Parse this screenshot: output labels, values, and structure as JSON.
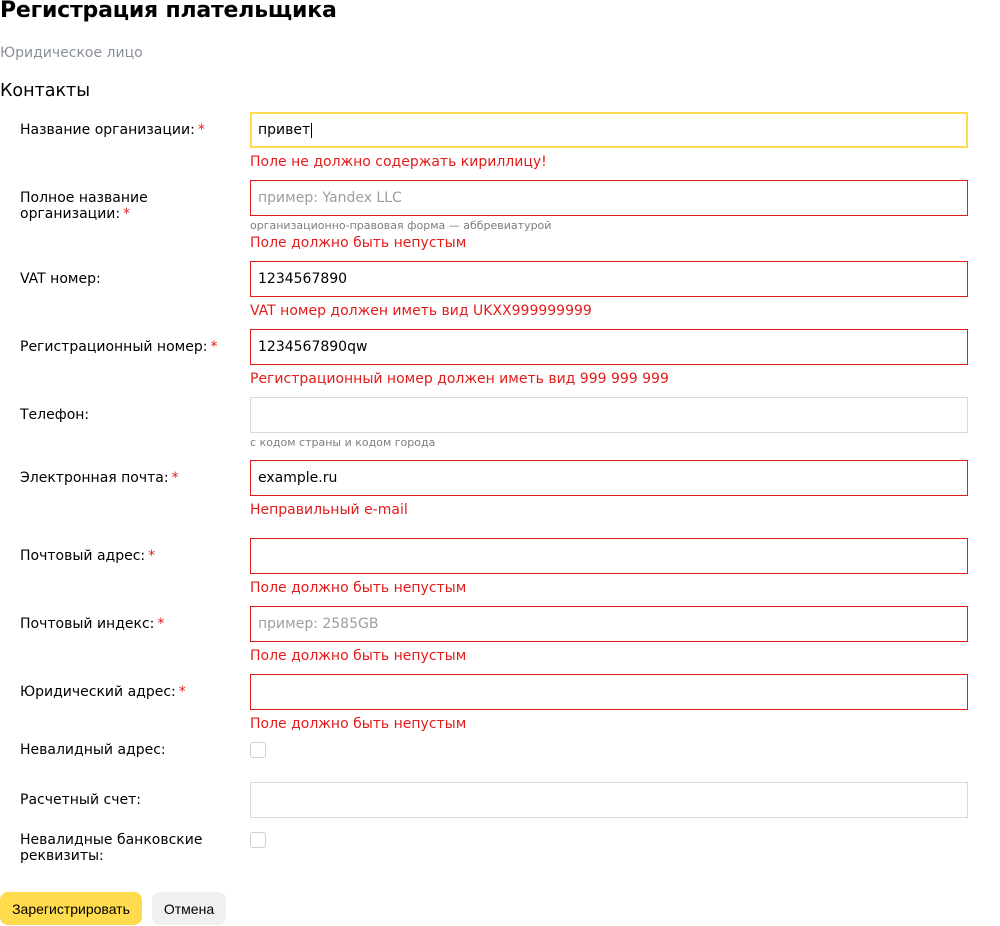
{
  "page": {
    "title": "Регистрация плательщика",
    "subtitle": "Юридическое лицо",
    "section": "Контакты",
    "required_mark": "*"
  },
  "fields": {
    "org_name": {
      "label": "Название организации:",
      "value": "привет",
      "error": "Поле не должно содержать кириллицу!"
    },
    "org_full_name": {
      "label": "Полное название организации:",
      "placeholder": "пример: Yandex LLC",
      "hint": "организационно-правовая форма — аббревиатурой",
      "error": "Поле должно быть непустым"
    },
    "vat": {
      "label": "VAT номер:",
      "value": "1234567890",
      "error": "VAT номер должен иметь вид UKXX999999999"
    },
    "reg_number": {
      "label": "Регистрационный номер:",
      "value": "1234567890qw",
      "error": "Регистрационный номер должен иметь вид 999 999 999"
    },
    "phone": {
      "label": "Телефон:",
      "hint": "с кодом страны и кодом города"
    },
    "email": {
      "label": "Электронная почта:",
      "value": "example.ru",
      "error": "Неправильный e-mail"
    },
    "postal_address": {
      "label": "Почтовый адрес:",
      "error": "Поле должно быть непустым"
    },
    "postal_index": {
      "label": "Почтовый индекс:",
      "placeholder": "пример: 2585GB",
      "error": "Поле должно быть непустым"
    },
    "legal_address": {
      "label": "Юридический адрес:",
      "error": "Поле должно быть непустым"
    },
    "invalid_address": {
      "label": "Невалидный адрес:",
      "checked": false
    },
    "account": {
      "label": "Расчетный счет:"
    },
    "invalid_bank": {
      "label": "Невалидные банковские реквизиты:",
      "checked": false
    }
  },
  "buttons": {
    "submit": "Зарегистрировать",
    "cancel": "Отмена"
  },
  "colors": {
    "accent": "#ffdb4d",
    "error": "#e31b1b",
    "secondary_button": "#f0f0f0"
  }
}
